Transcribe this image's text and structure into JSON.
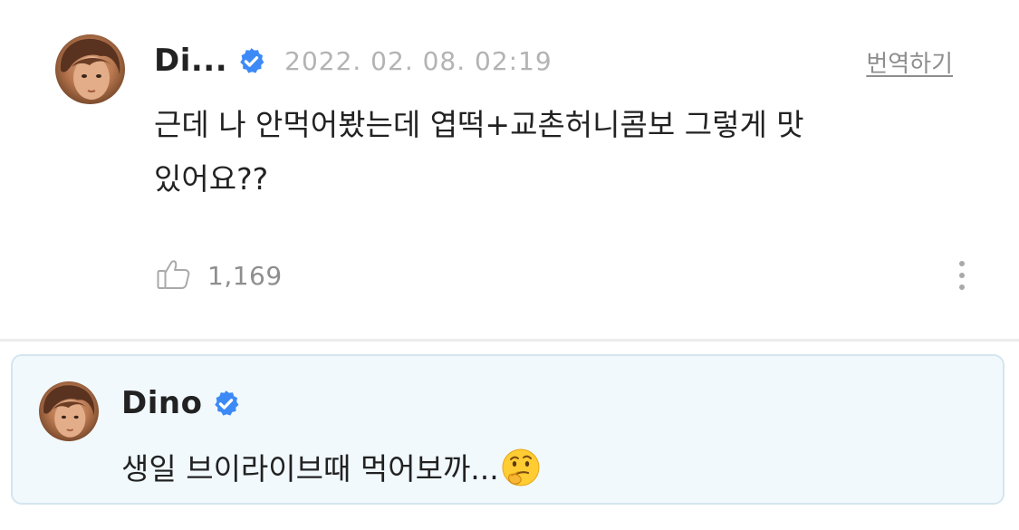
{
  "comment": {
    "author": "Di...",
    "date": "2022. 02. 08. 02:19",
    "translate_label": "번역하기",
    "text": "근데 나 안먹어봤는데 엽떡+교촌허니콤보 그렇게 맛있어요??",
    "like_count": "1,169",
    "verified": true
  },
  "reply": {
    "author": "Dino",
    "text": "생일 브이라이브때 먹어보까...",
    "emoji": "thinking-face",
    "verified": true
  },
  "colors": {
    "verified_badge": "#3d8af7",
    "reply_background": "#f2f9fd",
    "reply_border": "#d4e6ef",
    "muted_text": "#8e8e8e"
  }
}
